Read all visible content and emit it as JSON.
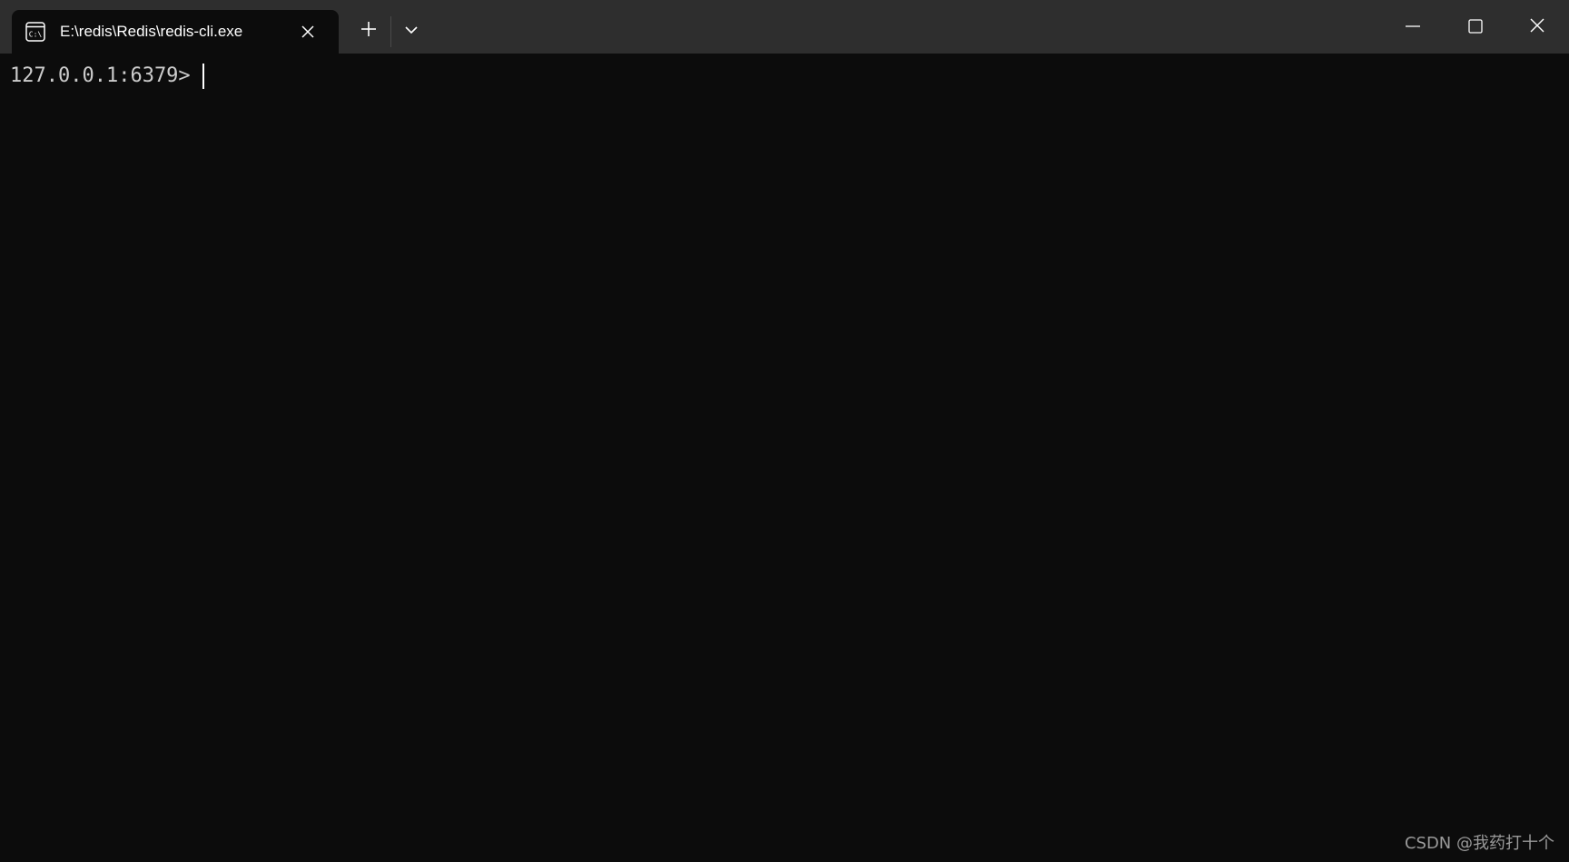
{
  "window": {
    "tab_title": "E:\\redis\\Redis\\redis-cli.exe",
    "tab_icon": "console-icon",
    "new_tab_label": "+",
    "controls": [
      "minimize",
      "maximize",
      "close"
    ]
  },
  "terminal": {
    "prompt": "127.0.0.1:6379>",
    "input": ""
  },
  "watermark": {
    "text": "CSDN @我药打十个"
  },
  "colors": {
    "titlebar": "#2e2e2e",
    "terminal_bg": "#0c0c0c",
    "terminal_text": "#cccccc"
  }
}
